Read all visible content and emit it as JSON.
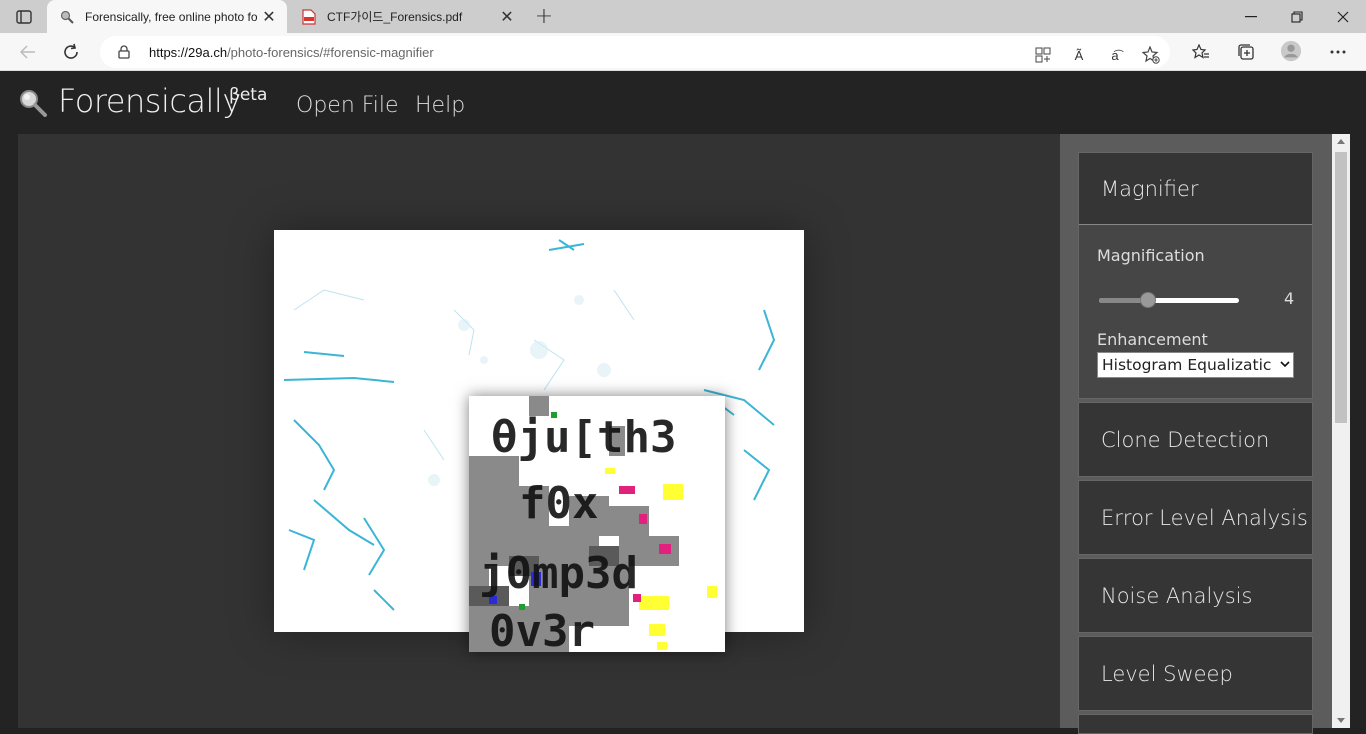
{
  "browser": {
    "tabs": [
      {
        "title": "Forensically, free online photo fo",
        "active": true,
        "icon": "magnifier-favicon"
      },
      {
        "title": "CTF가이드_Forensics.pdf",
        "active": false,
        "icon": "pdf-favicon"
      }
    ],
    "url_host": "https://29a.ch",
    "url_path": "/photo-forensics/#forensic-magnifier",
    "reader_icon_label": "Ã",
    "translate_icon_label": "a͡"
  },
  "app": {
    "brand": "Forensically",
    "beta": "βeta",
    "nav": {
      "open_file": "Open File",
      "help": "Help"
    }
  },
  "magnifier_text_lines": [
    "θju[th3",
    "f0x",
    "j0mp3d",
    "0v3r"
  ],
  "sidebar": {
    "open_panel": {
      "title": "Magnifier",
      "magnification_label": "Magnification",
      "magnification_value": "4",
      "magnification_fraction": 0.35,
      "enhancement_label": "Enhancement",
      "enhancement_value": "Histogram Equalizatic"
    },
    "panels": [
      {
        "title": "Clone Detection"
      },
      {
        "title": "Error Level Analysis"
      },
      {
        "title": "Noise Analysis"
      },
      {
        "title": "Level Sweep"
      }
    ]
  },
  "colors": {
    "accent_cyan": "#1aa9cf",
    "magnifier_yellow": "#ffff33",
    "magnifier_pink": "#e2207e",
    "dark_bg": "#232323"
  }
}
